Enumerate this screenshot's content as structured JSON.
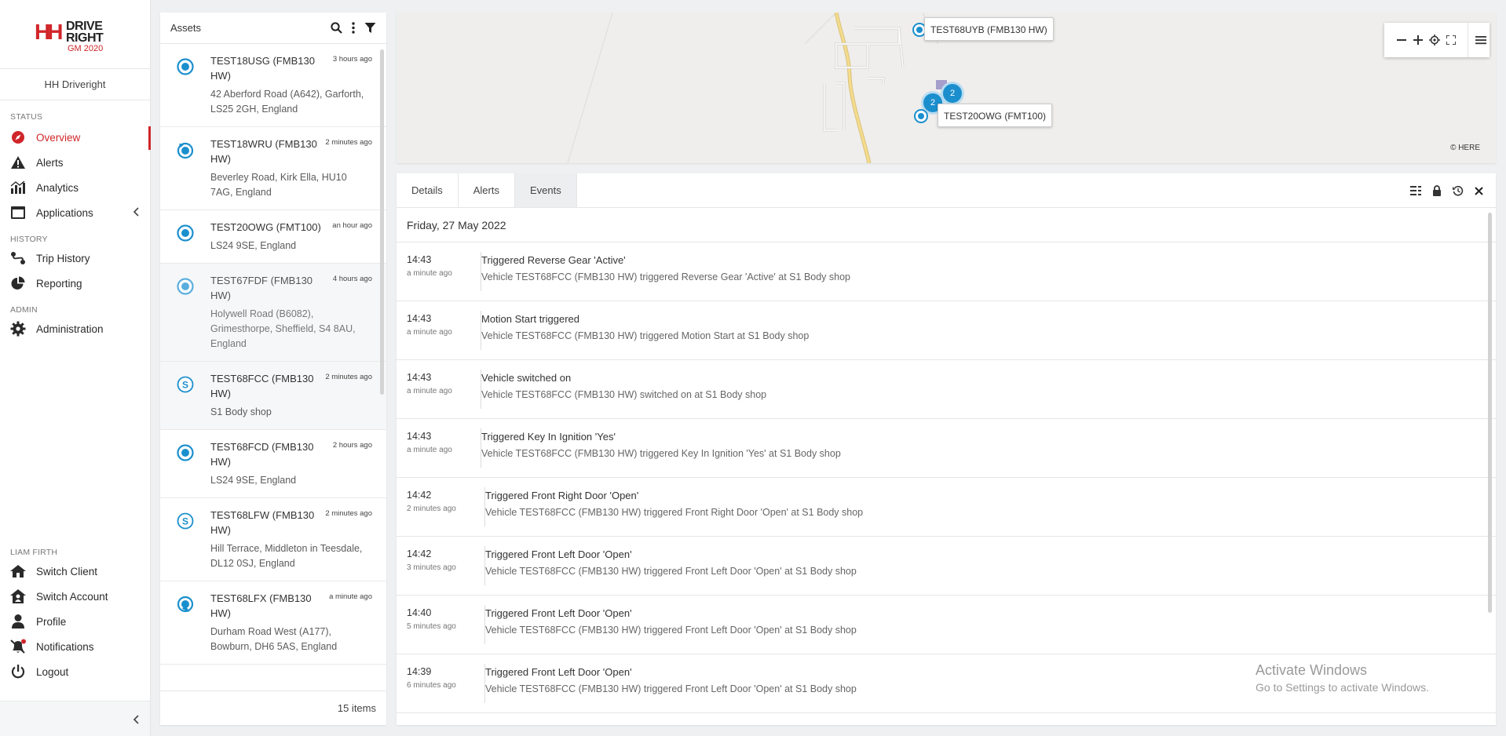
{
  "brand": {
    "logo_mark": "HH",
    "logo_line1": "DRIVE",
    "logo_line2": "RIGHT",
    "logo_line3": "GM 2020",
    "accent": "#d0262a"
  },
  "client_name": "HH Driveright",
  "nav": {
    "status_heading": "STATUS",
    "overview": "Overview",
    "alerts": "Alerts",
    "analytics": "Analytics",
    "applications": "Applications",
    "history_heading": "HISTORY",
    "trip_history": "Trip History",
    "reporting": "Reporting",
    "admin_heading": "ADMIN",
    "administration": "Administration",
    "user_heading": "LIAM FIRTH",
    "switch_client": "Switch Client",
    "switch_account": "Switch Account",
    "profile": "Profile",
    "notifications": "Notifications",
    "logout": "Logout"
  },
  "assets": {
    "title": "Assets",
    "count": "15 items",
    "items": [
      {
        "name": "TEST18USG (FMB130 HW)",
        "time": "3 hours ago",
        "address": "42 Aberford Road (A642), Garforth, LS25 2GH, England",
        "icon": "location-pin-icon"
      },
      {
        "name": "TEST18WRU (FMB130 HW)",
        "time": "2 minutes ago",
        "address": "Beverley Road, Kirk Ella, HU10 7AG, England",
        "icon": "heading-pin-icon"
      },
      {
        "name": "TEST20OWG (FMT100)",
        "time": "an hour ago",
        "address": "LS24 9SE, England",
        "icon": "location-pin-icon"
      },
      {
        "name": "TEST67FDF (FMB130 HW)",
        "time": "4 hours ago",
        "address": "Holywell Road (B6082), Grimesthorpe, Sheffield, S4 8AU, England",
        "icon": "location-pin-faded-icon"
      },
      {
        "name": "TEST68FCC (FMB130 HW)",
        "time": "2 minutes ago",
        "address": "S1 Body shop",
        "icon": "stopped-s-icon"
      },
      {
        "name": "TEST68FCD (FMB130 HW)",
        "time": "2 hours ago",
        "address": "LS24 9SE, England",
        "icon": "location-pin-icon"
      },
      {
        "name": "TEST68LFW (FMB130 HW)",
        "time": "2 minutes ago",
        "address": "Hill Terrace, Middleton in Teesdale, DL12 0SJ, England",
        "icon": "stopped-s-icon"
      },
      {
        "name": "TEST68LFX (FMB130 HW)",
        "time": "a minute ago",
        "address": "Durham Road West (A177), Bowburn, DH6 5AS, England",
        "icon": "heading-pin-icon"
      }
    ]
  },
  "map": {
    "label_a": "TEST68UYB (FMB130 HW)",
    "label_b": "TEST20OWG (FMT100)",
    "cluster_a": "2",
    "cluster_b": "2",
    "copyright": "© HERE"
  },
  "events_panel": {
    "tabs": [
      "Details",
      "Alerts",
      "Events"
    ],
    "active_tab": "Events",
    "date": "Friday, 27 May 2022",
    "events": [
      {
        "time": "14:43",
        "ago": "a minute ago",
        "title": "Triggered Reverse Gear 'Active'",
        "desc": "Vehicle TEST68FCC (FMB130 HW) triggered Reverse Gear 'Active' at S1 Body shop"
      },
      {
        "time": "14:43",
        "ago": "a minute ago",
        "title": "Motion Start triggered",
        "desc": "Vehicle TEST68FCC (FMB130 HW) triggered Motion Start at S1 Body shop"
      },
      {
        "time": "14:43",
        "ago": "a minute ago",
        "title": "Vehicle switched on",
        "desc": "Vehicle TEST68FCC (FMB130 HW) switched on at S1 Body shop"
      },
      {
        "time": "14:43",
        "ago": "a minute ago",
        "title": "Triggered Key In Ignition 'Yes'",
        "desc": "Vehicle TEST68FCC (FMB130 HW) triggered Key In Ignition 'Yes' at S1 Body shop"
      },
      {
        "time": "14:42",
        "ago": "2 minutes ago",
        "title": "Triggered Front Right Door 'Open'",
        "desc": "Vehicle TEST68FCC (FMB130 HW) triggered Front Right Door 'Open' at S1 Body shop"
      },
      {
        "time": "14:42",
        "ago": "3 minutes ago",
        "title": "Triggered Front Left Door 'Open'",
        "desc": "Vehicle TEST68FCC (FMB130 HW) triggered Front Left Door 'Open' at S1 Body shop"
      },
      {
        "time": "14:40",
        "ago": "5 minutes ago",
        "title": "Triggered Front Left Door 'Open'",
        "desc": "Vehicle TEST68FCC (FMB130 HW) triggered Front Left Door 'Open' at S1 Body shop"
      },
      {
        "time": "14:39",
        "ago": "6 minutes ago",
        "title": "Triggered Front Left Door 'Open'",
        "desc": "Vehicle TEST68FCC (FMB130 HW) triggered Front Left Door 'Open' at S1 Body shop"
      }
    ]
  },
  "watermark": {
    "line1": "Activate Windows",
    "line2": "Go to Settings to activate Windows."
  }
}
